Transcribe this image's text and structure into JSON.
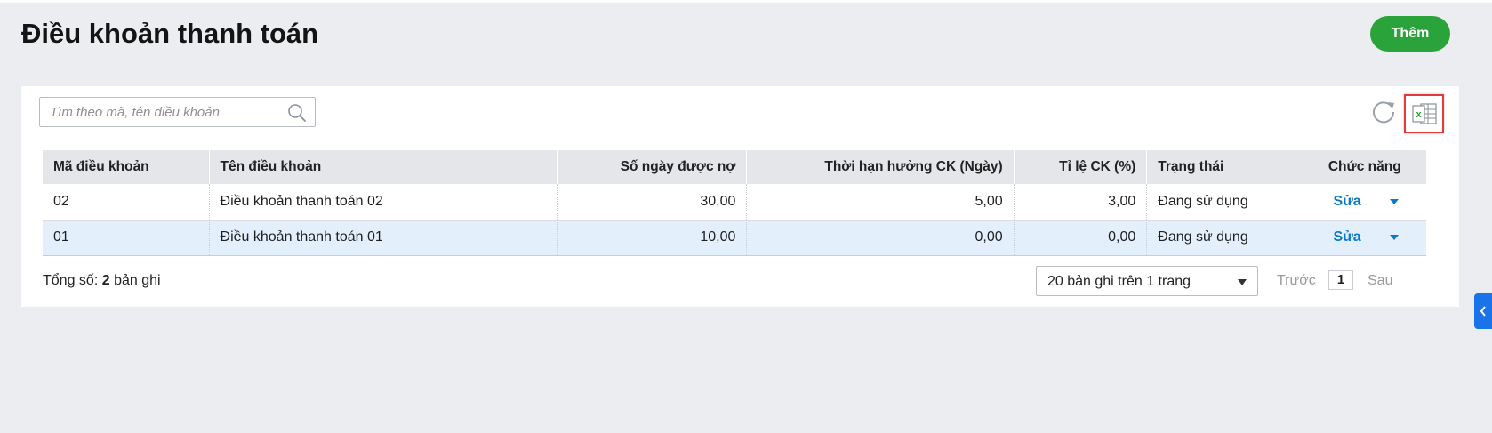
{
  "header": {
    "title": "Điều khoản thanh toán",
    "add_label": "Thêm"
  },
  "toolbar": {
    "search_placeholder": "Tìm theo mã, tên điều khoản",
    "search_value": ""
  },
  "icons": {
    "search": "search-icon",
    "refresh": "refresh-icon",
    "export": "excel-icon",
    "side_toggle": "chevron-left-icon"
  },
  "colors": {
    "accent": "#2aa33a",
    "link": "#0b79c8",
    "highlight_row": "#e3f0fc",
    "export_outline": "#e0393e"
  },
  "table": {
    "columns": [
      "Mã điều khoản",
      "Tên điều khoản",
      "Số ngày được nợ",
      "Thời hạn hưởng CK (Ngày)",
      "Tỉ lệ CK (%)",
      "Trạng thái",
      "Chức năng"
    ],
    "rows": [
      {
        "code": "02",
        "name": "Điều khoản thanh toán 02",
        "credit_days": "30,00",
        "discount_days": "5,00",
        "discount_rate": "3,00",
        "status": "Đang sử dụng",
        "action": "Sửa"
      },
      {
        "code": "01",
        "name": "Điều khoản thanh toán 01",
        "credit_days": "10,00",
        "discount_days": "0,00",
        "discount_rate": "0,00",
        "status": "Đang sử dụng",
        "action": "Sửa"
      }
    ]
  },
  "footer": {
    "total_prefix": "Tổng số:",
    "total_count": "2",
    "total_suffix": "bản ghi",
    "page_size": "20 bản ghi trên 1 trang",
    "prev_label": "Trước",
    "current_page": "1",
    "next_label": "Sau"
  }
}
